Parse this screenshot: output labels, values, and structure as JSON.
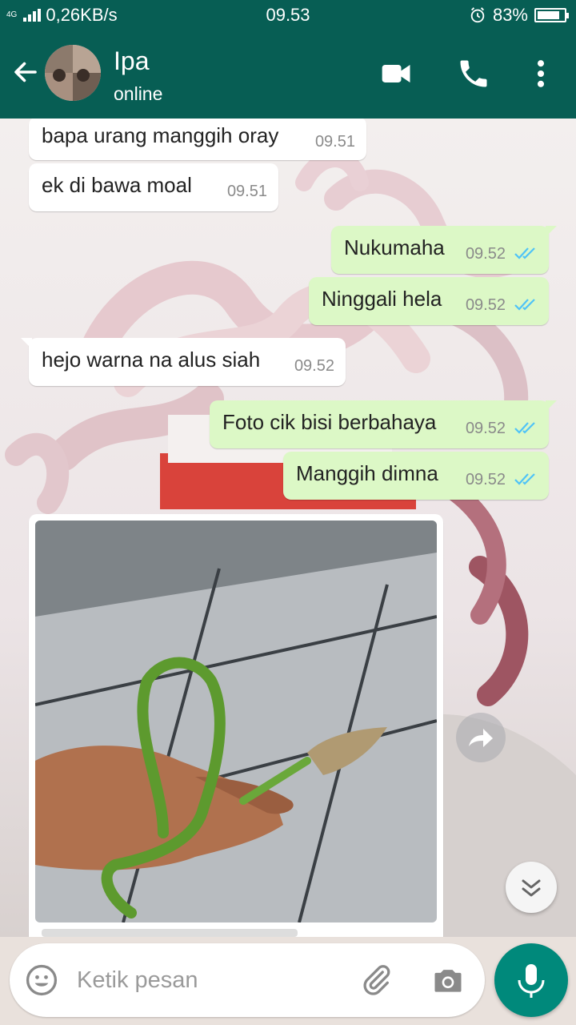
{
  "status_bar": {
    "network_tag": "4G",
    "speed": "0,26KB/s",
    "time": "09.53",
    "battery_percent": "83%",
    "battery_level": 0.83,
    "icons": [
      "signal-icon",
      "alarm-icon",
      "battery-icon"
    ]
  },
  "header": {
    "contact_name": "Ipa",
    "status": "online",
    "icons": [
      "back-arrow-icon",
      "video-call-icon",
      "voice-call-icon",
      "more-menu-icon"
    ]
  },
  "messages": [
    {
      "direction": "in",
      "text": "bapa urang manggih oray",
      "time": "09.51"
    },
    {
      "direction": "in",
      "text": "ek di bawa moal",
      "time": "09.51"
    },
    {
      "direction": "out",
      "text": "Nukumaha",
      "time": "09.52",
      "status": "read"
    },
    {
      "direction": "out",
      "text": "Ninggali hela",
      "time": "09.52",
      "status": "read"
    },
    {
      "direction": "in",
      "text": "hejo warna na alus siah",
      "time": "09.52"
    },
    {
      "direction": "out",
      "text": "Foto cik bisi berbahaya",
      "time": "09.52",
      "status": "read"
    },
    {
      "direction": "out",
      "text": "Manggih dimna",
      "time": "09.52",
      "status": "read"
    },
    {
      "direction": "in",
      "type": "image",
      "image_description": "hand holding a long green vine snake"
    }
  ],
  "composer": {
    "placeholder": "Ketik pesan",
    "icons": [
      "emoji-icon",
      "attach-icon",
      "camera-icon",
      "mic-icon"
    ]
  },
  "floating": {
    "icons": [
      "forward-icon",
      "scroll-down-icon"
    ]
  },
  "colors": {
    "header": "#075e54",
    "incoming_bubble": "#ffffff",
    "outgoing_bubble": "#dcf8c6",
    "read_ticks": "#4fc3f7",
    "fab": "#00897b"
  }
}
